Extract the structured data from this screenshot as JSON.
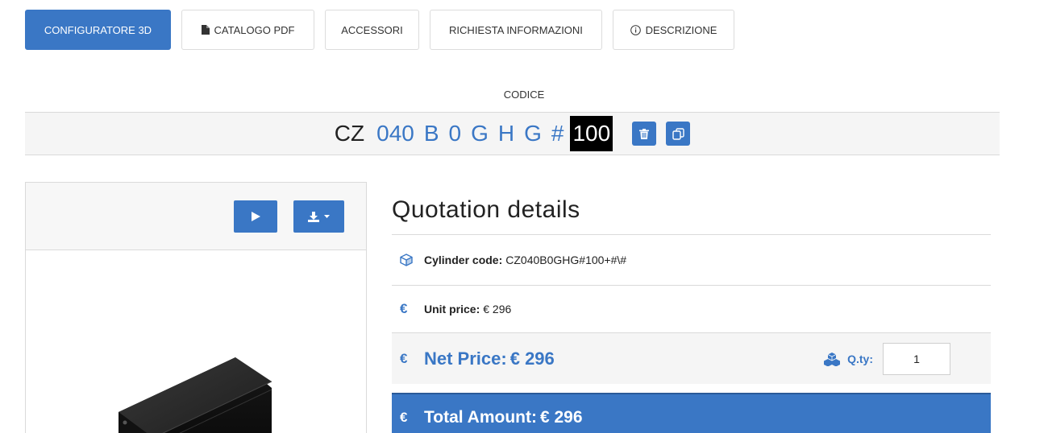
{
  "tabs": [
    {
      "label": "CONFIGURATORE 3D",
      "active": true,
      "icon": ""
    },
    {
      "label": "CATALOGO PDF",
      "active": false,
      "icon": "file-icon"
    },
    {
      "label": "ACCESSORI",
      "active": false,
      "icon": ""
    },
    {
      "label": "RICHIESTA INFORMAZIONI",
      "active": false,
      "icon": ""
    },
    {
      "label": "DESCRIZIONE",
      "active": false,
      "icon": "info-circle-icon"
    }
  ],
  "code": {
    "label": "CODICE",
    "prefix": "CZ",
    "segments": [
      "040",
      "B",
      "0",
      "G",
      "H",
      "G",
      "#"
    ],
    "highlight": "100"
  },
  "viewer": {
    "play_icon": "play-icon",
    "download_icon": "download-icon"
  },
  "quotation": {
    "title": "Quotation details",
    "cylinder_code_label": "Cylinder code:",
    "cylinder_code_value": "CZ040B0GHG#100+#\\#",
    "unit_price_label": "Unit price:",
    "unit_price_value": "€ 296",
    "net_price_label": "Net Price:",
    "net_price_value": "€ 296",
    "qty_label": "Q.ty:",
    "qty_value": "1",
    "total_label": "Total Amount:",
    "total_value": "€ 296",
    "euro_symbol": "€"
  },
  "colors": {
    "accent": "#3a77c5",
    "highlight_bg": "#000000"
  }
}
